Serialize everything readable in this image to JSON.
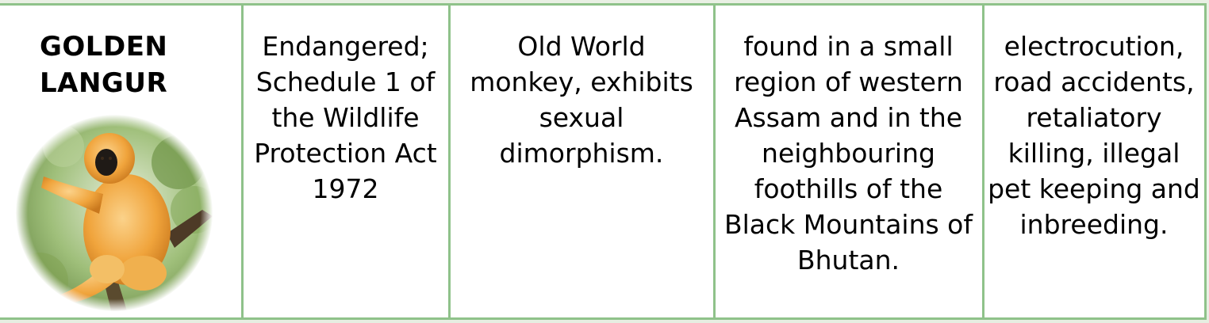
{
  "rows": [
    {
      "species": {
        "name": "GOLDEN\nLANGUR",
        "image": "golden-langur-photo"
      },
      "status": "Endangered; Schedule 1 of the Wildlife Protection Act 1972",
      "description": "Old World monkey, exhibits sexual dimorphism.",
      "distribution": "found in a small region of western Assam and in the neighbouring foothills of the Black Mountains of Bhutan.",
      "threats": "electrocution, road accidents, retaliatory killing, illegal pet keeping and inbreeding."
    }
  ],
  "colors": {
    "border": "#8fc28a",
    "background": "#eef3ea",
    "text": "#000000"
  }
}
